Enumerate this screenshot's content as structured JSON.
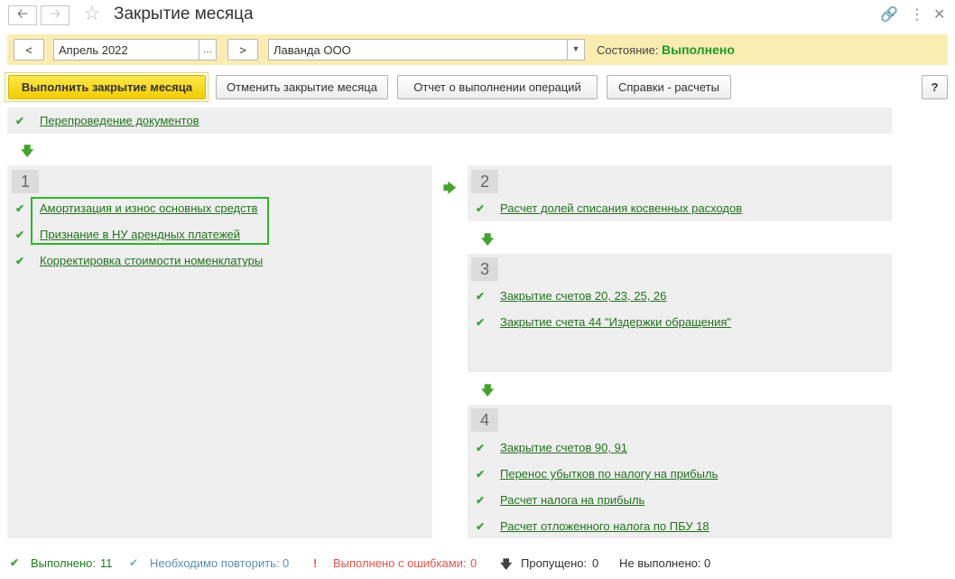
{
  "header": {
    "title": "Закрытие месяца",
    "back_icon": "arrow-left-icon",
    "forward_icon": "arrow-right-icon"
  },
  "filter": {
    "prev_label": "<",
    "period": "Апрель 2022",
    "period_select": "...",
    "next_label": ">",
    "organization": "Лаванда ООО",
    "state_label": "Состояние:",
    "state_value": "Выполнено"
  },
  "actions": {
    "run": "Выполнить закрытие месяца",
    "cancel": "Отменить закрытие месяца",
    "report": "Отчет о выполнении операций",
    "references": "Справки - расчеты",
    "help": "?"
  },
  "pre_step": {
    "label": "Перепроведение документов"
  },
  "steps": [
    {
      "number": "1",
      "items": [
        "Амортизация и износ основных средств",
        "Признание в НУ арендных платежей",
        "Корректировка стоимости номенклатуры"
      ]
    },
    {
      "number": "2",
      "items": [
        "Расчет долей списания косвенных расходов"
      ]
    },
    {
      "number": "3",
      "items": [
        "Закрытие счетов 20, 23, 25, 26",
        "Закрытие счета 44 \"Издержки обращения\""
      ]
    },
    {
      "number": "4",
      "items": [
        "Закрытие счетов 90, 91",
        "Перенос убытков по налогу на прибыль",
        "Расчет налога на прибыль",
        "Расчет отложенного налога по ПБУ 18"
      ]
    }
  ],
  "status": {
    "done_label": "Выполнено:",
    "done_value": "11",
    "repeat_label": "Необходимо повторить:",
    "repeat_value": "0",
    "errors_label": "Выполнено с ошибками:",
    "errors_value": "0",
    "skipped_label": "Пропущено:",
    "skipped_value": "0",
    "not_done_label": "Не выполнено:",
    "not_done_value": "0"
  },
  "colors": {
    "done": "#1d9b23",
    "repeat": "#5b8fb0",
    "errors": "#e0554d",
    "panel": "#efefef",
    "toolbar": "#fbedb2"
  }
}
